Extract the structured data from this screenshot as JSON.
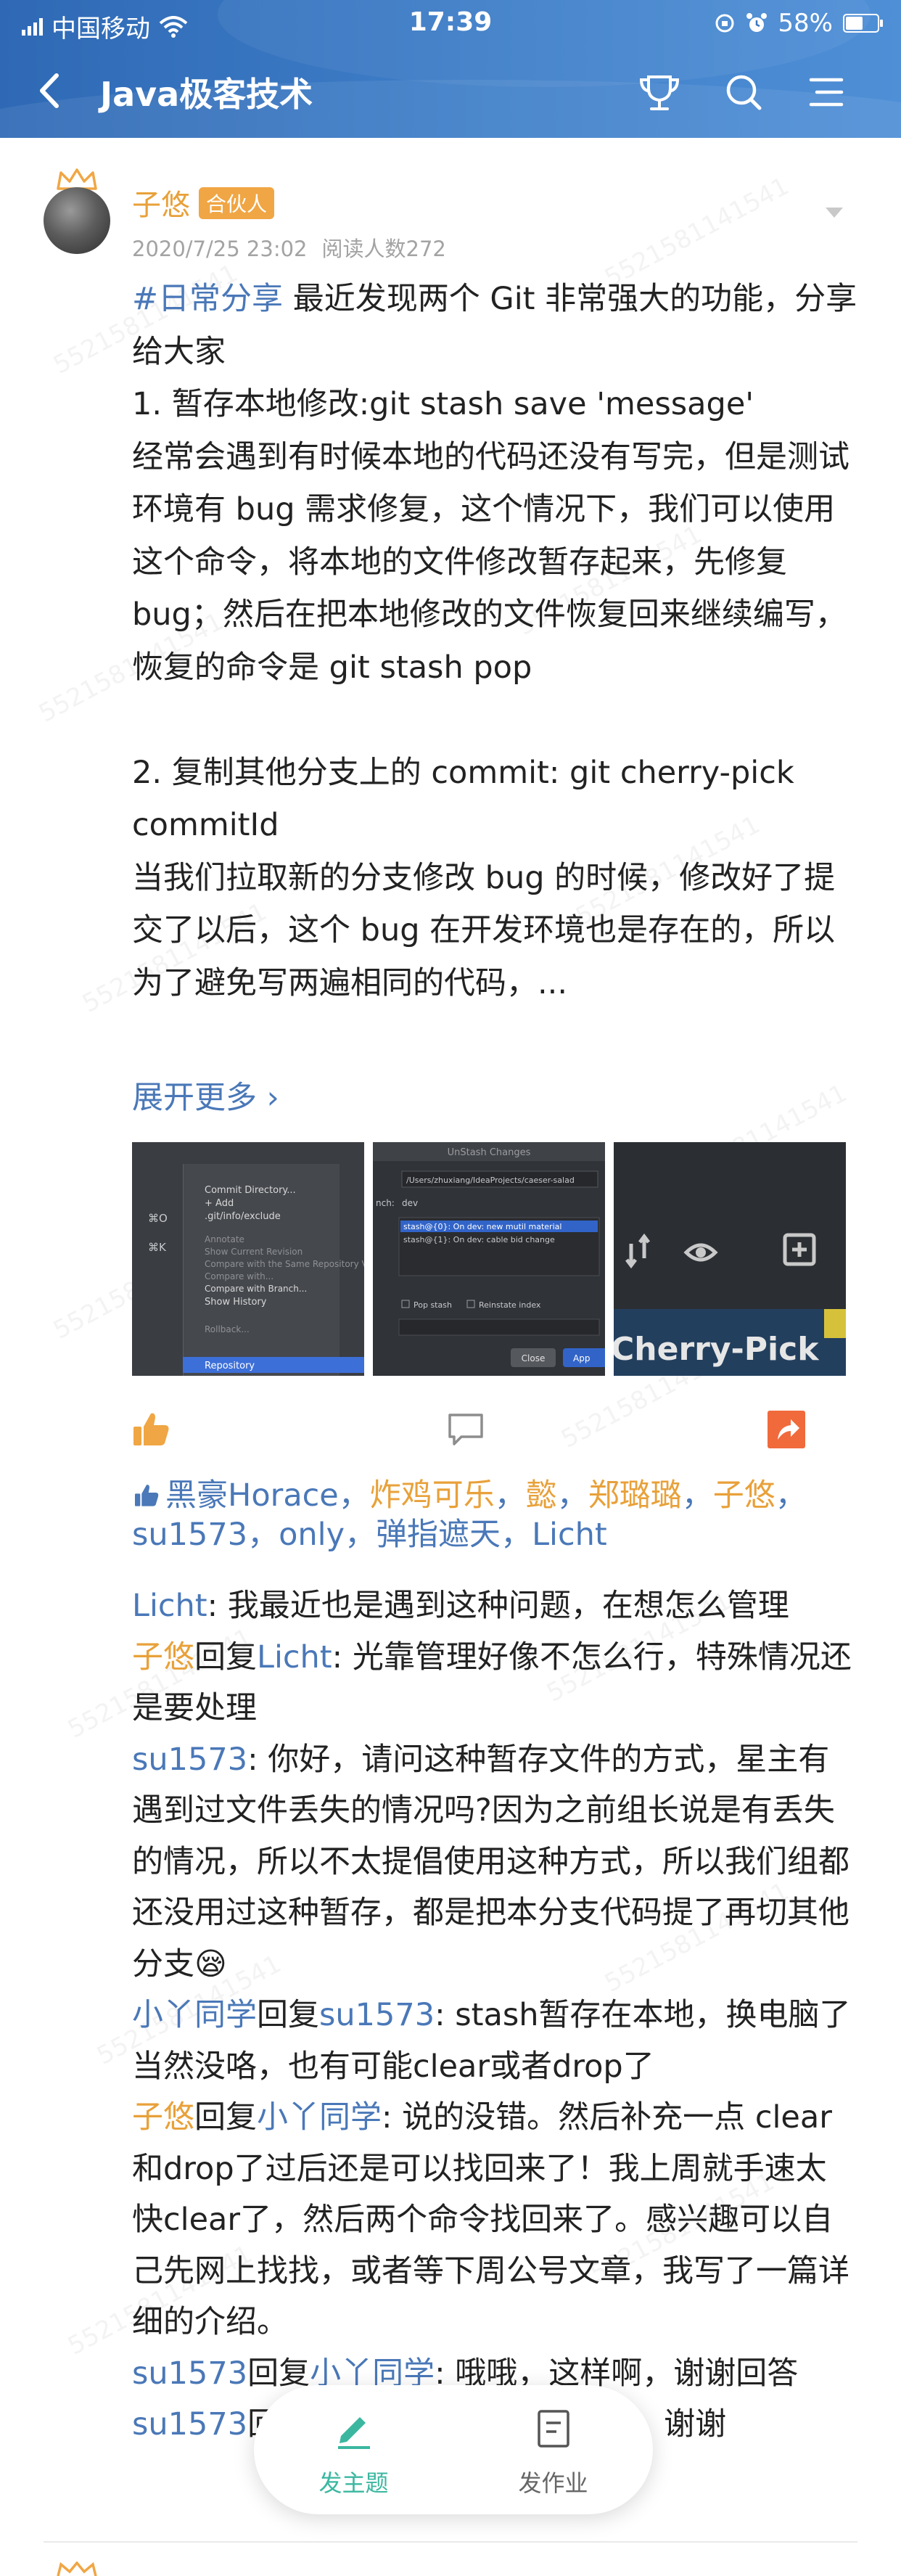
{
  "status_bar": {
    "carrier": "中国移动",
    "time": "17:39",
    "battery": "58%",
    "battery_level": 0.58
  },
  "nav": {
    "title": "Java极客技术",
    "icons": [
      "back-icon",
      "trophy-icon",
      "search-icon",
      "menu-icon"
    ]
  },
  "post": {
    "author": "子悠",
    "badge": "合伙人",
    "date": "2020/7/25 23:02",
    "reads": "阅读人数272",
    "content": {
      "hashtag": "#日常分享",
      "line1": " 最近发现两个 Git 非常强大的功能，分享给大家",
      "p1_title": "1. 暂存本地修改:git stash save 'message'",
      "p1_body": "经常会遇到有时候本地的代码还没有写完，但是测试环境有 bug 需求修复，这个情况下，我们可以使用这个命令，将本地的文件修改暂存起来，先修复 bug；然后在把本地修改的文件恢复回来继续编写，恢复的命令是 git stash pop",
      "p2_title": "2. 复制其他分支上的 commit: git cherry-pick commitId",
      "p2_body": "当我们拉取新的分支修改 bug 的时候，修改好了提交了以后，这个 bug 在开发环境也是存在的，所以为了避免写两遍相同的代码，..."
    },
    "expand": "展开更多 ›",
    "images": {
      "img1_items": [
        "Commit Directory...",
        "+ Add",
        ".git/info/exclude",
        "Annotate",
        "Show Current Revision",
        "Compare with the Same Repository Version",
        "Compare with...",
        "Compare with Branch...",
        "Show History",
        "Rollback...",
        "Repository"
      ],
      "img1_keys": [
        "⌘O",
        "⌘K"
      ],
      "img2_title": "UnStash Changes",
      "img2_path": "/Users/zhuxiang/IdeaProjects/caeser-salad",
      "img2_branch_label": "nch:",
      "img2_branch": "dev",
      "img2_stash1": "stash@{0}: On dev: new mutil material",
      "img2_stash2": "stash@{1}: On dev: cable bid change",
      "img2_pop": "Pop stash",
      "img2_reinstate": "Reinstate index",
      "img2_close": "Close",
      "img2_apply": "App",
      "img3_text": "Cherry-Pick"
    },
    "likes": [
      {
        "name": "黑豪Horace",
        "color": "blue",
        "sep": "，"
      },
      {
        "name": "炸鸡可乐",
        "color": "orange",
        "sep": "，"
      },
      {
        "name": "懿",
        "color": "orange",
        "sep": "，"
      },
      {
        "name": "郑璐璐",
        "color": "orange",
        "sep": "，"
      },
      {
        "name": "子悠",
        "color": "orange",
        "sep": "，"
      },
      {
        "name": "su1573",
        "color": "blue",
        "sep": "，"
      },
      {
        "name": "only",
        "color": "blue",
        "sep": "，"
      },
      {
        "name": "弹指遮天",
        "color": "blue",
        "sep": "，"
      },
      {
        "name": "Licht",
        "color": "blue",
        "sep": ""
      }
    ],
    "comments": [
      {
        "from": "Licht",
        "from_color": "blue",
        "to": "",
        "to_color": "",
        "text": ": 我最近也是遇到这种问题，在想怎么管理"
      },
      {
        "from": "子悠",
        "from_color": "orange",
        "to": "Licht",
        "to_color": "blue",
        "text": ": 光靠管理好像不怎么行，特殊情况还是要处理"
      },
      {
        "from": "su1573",
        "from_color": "blue",
        "to": "",
        "to_color": "",
        "text": ": 你好，请问这种暂存文件的方式，星主有遇到过文件丢失的情况吗?因为之前组长说是有丢失的情况，所以不太提倡使用这种方式，所以我们组都还没用过这种暂存，都是把本分支代码提了再切其他分支😪"
      },
      {
        "from": "小丫同学",
        "from_color": "blue",
        "to": "su1573",
        "to_color": "blue",
        "text": ": stash暂存在本地，换电脑了当然没咯，也有可能clear或者drop了"
      },
      {
        "from": "子悠",
        "from_color": "orange",
        "to": "小丫同学",
        "to_color": "blue",
        "text": ": 说的没错。然后补充一点 clear和drop了过后还是可以找回来了！我上周就手速太快clear了，然后两个命令找回来了。感兴趣可以自己先网上找找，或者等下周公号文章，我写了一篇详细的介绍。"
      },
      {
        "from": "su1573",
        "from_color": "blue",
        "to": "小丫同学",
        "to_color": "blue",
        "text": ": 哦哦，这样啊，谢谢回答"
      },
      {
        "from": "su1573",
        "from_color": "blue",
        "to": "",
        "to_color": "",
        "text_visible_start": "回",
        "text": "试，研究一下，谢谢"
      }
    ],
    "reply_word": "回复"
  },
  "fab": {
    "left_label": "发主题",
    "right_label": "发作业",
    "accent": "#3bb7a0"
  },
  "watermark": "5521581141541",
  "colors": {
    "blue_link": "#4a78b8",
    "orange_name": "#e8a13a",
    "header_blue": "#3a76c2"
  }
}
